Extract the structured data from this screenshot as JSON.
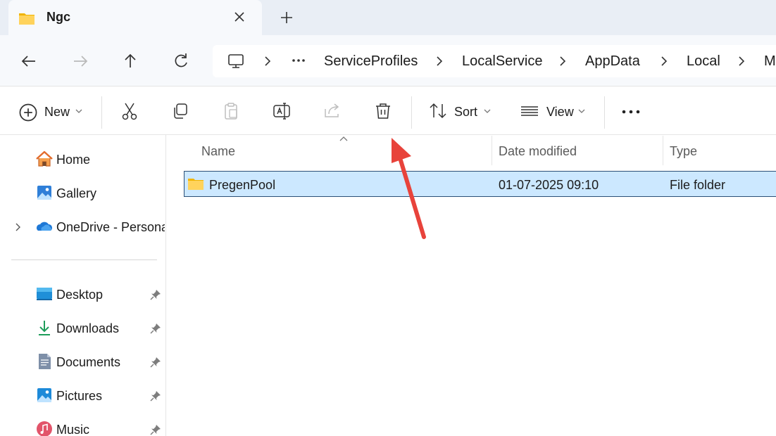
{
  "window": {
    "tab_title": "Ngc"
  },
  "breadcrumb": {
    "items": [
      "ServiceProfiles",
      "LocalService",
      "AppData",
      "Local",
      "M"
    ]
  },
  "toolbar": {
    "new_label": "New",
    "sort_label": "Sort",
    "view_label": "View"
  },
  "sidebar": {
    "quick": [
      {
        "label": "Home",
        "icon": "home-icon"
      },
      {
        "label": "Gallery",
        "icon": "gallery-icon"
      },
      {
        "label": "OneDrive - Persona",
        "icon": "onedrive-icon"
      }
    ],
    "pinned": [
      {
        "label": "Desktop",
        "icon": "desktop-icon"
      },
      {
        "label": "Downloads",
        "icon": "downloads-icon"
      },
      {
        "label": "Documents",
        "icon": "documents-icon"
      },
      {
        "label": "Pictures",
        "icon": "pictures-icon"
      },
      {
        "label": "Music",
        "icon": "music-icon"
      }
    ]
  },
  "file_list": {
    "columns": [
      "Name",
      "Date modified",
      "Type"
    ],
    "rows": [
      {
        "name": "PregenPool",
        "date_modified": "01-07-2025 09:10",
        "type": "File folder",
        "selected": true
      }
    ]
  },
  "colors": {
    "selection_fill": "#cce8ff",
    "selection_border": "#2b4f77",
    "annotation_arrow": "#e8433b",
    "folder": "#f4c430"
  }
}
